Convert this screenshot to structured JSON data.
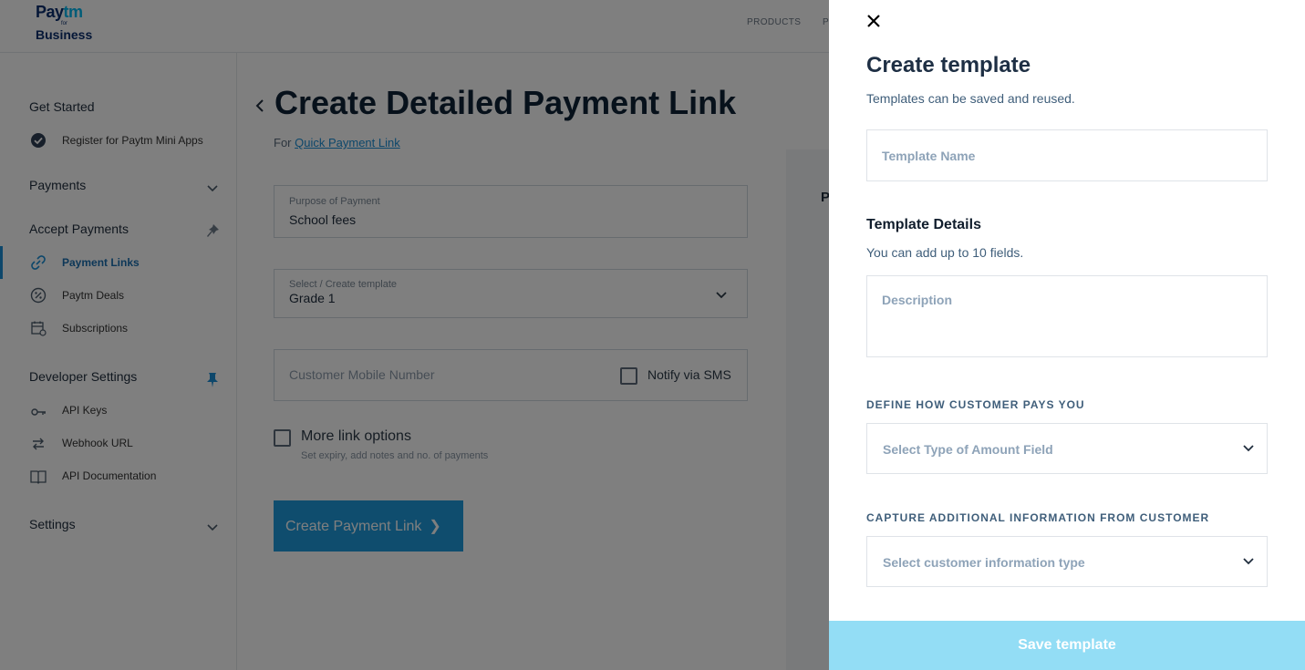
{
  "logo": {
    "line1_a": "Pay",
    "line1_b": "tm",
    "line2": "for",
    "line3": "Business"
  },
  "topnav": {
    "products": "PRODUCTS",
    "partial": "P"
  },
  "sidebar": {
    "get_started": "Get Started",
    "register_item": "Register for Paytm Mini Apps",
    "payments": "Payments",
    "accept_payments": "Accept Payments",
    "accept_items": [
      "Payment Links",
      "Paytm Deals",
      "Subscriptions"
    ],
    "developer_settings": "Developer Settings",
    "developer_items": [
      "API Keys",
      "Webhook URL",
      "API Documentation"
    ],
    "settings": "Settings",
    "accent_color": "#1b8fd6"
  },
  "main": {
    "title": "Create Detailed Payment Link",
    "for_prefix": "For",
    "for_link": "Quick Payment Link",
    "purpose_label": "Purpose of Payment",
    "purpose_value": "School fees",
    "template_label": "Select / Create template",
    "template_value": "Grade 1",
    "mobile_placeholder": "Customer Mobile Number",
    "notify_sms": "Notify via SMS",
    "more_options": "More link options",
    "more_options_sub": "Set expiry, add notes and no. of payments",
    "create_button": "Create Payment Link",
    "preview_letter": "P"
  },
  "drawer": {
    "title": "Create template",
    "subtitle": "Templates can be saved and reused.",
    "template_name_placeholder": "Template Name",
    "details_heading": "Template Details",
    "details_sub": "You can add up to 10 fields.",
    "description_placeholder": "Description",
    "define_heading": "DEFINE HOW CUSTOMER PAYS YOU",
    "amount_select": "Select Type of Amount Field",
    "capture_heading": "CAPTURE ADDITIONAL INFORMATION FROM CUSTOMER",
    "info_select": "Select customer information type",
    "save_button": "Save template",
    "save_color": "#93ddf5"
  }
}
